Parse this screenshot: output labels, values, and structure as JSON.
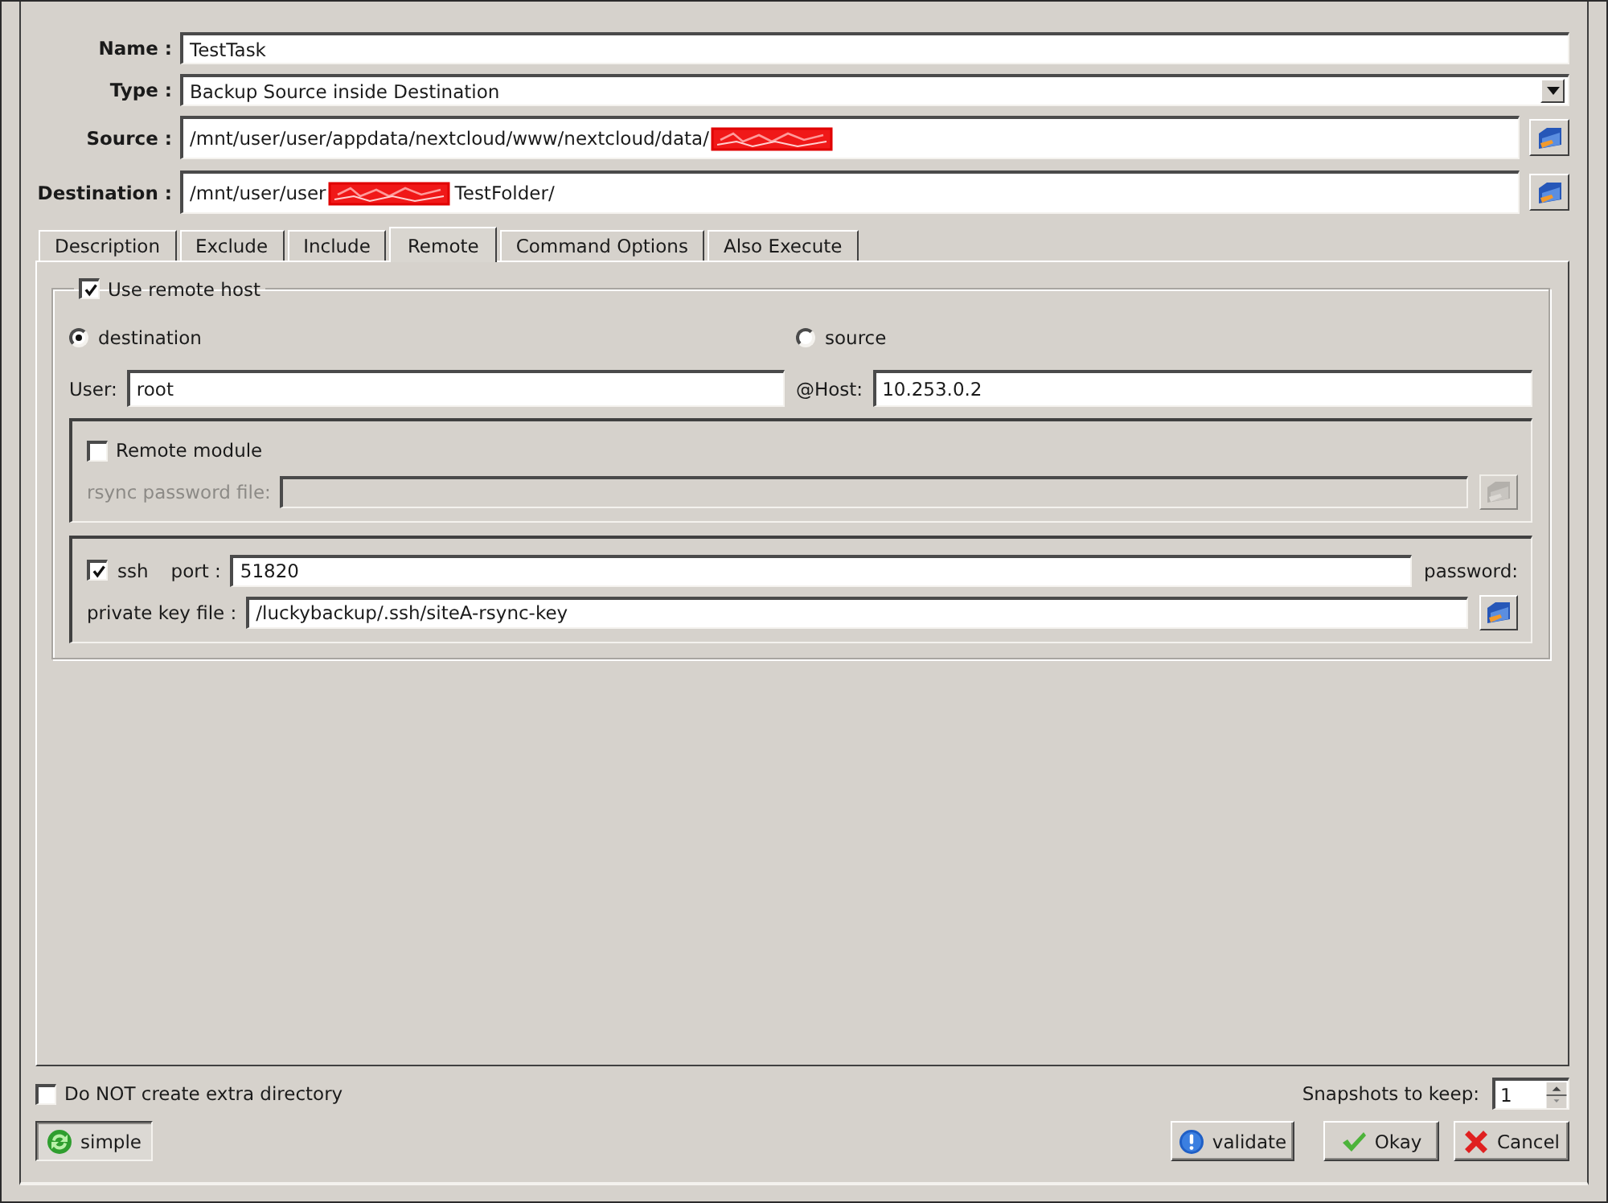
{
  "form": {
    "fields": [
      {
        "kind": "text",
        "label": "Name :",
        "value": "TestTask"
      },
      {
        "kind": "dropdown",
        "label": "Type :",
        "value": "Backup Source inside Destination"
      },
      {
        "kind": "path",
        "label": "Source :",
        "parts": [
          {
            "kind": "text",
            "text": "/mnt/user/user/appdata/nextcloud/www/nextcloud/data/"
          },
          {
            "kind": "redacted"
          }
        ]
      },
      {
        "kind": "path",
        "label": "Destination :",
        "parts": [
          {
            "kind": "text",
            "text": "/mnt/user/user"
          },
          {
            "kind": "redacted"
          },
          {
            "kind": "text",
            "text": "TestFolder/"
          }
        ]
      }
    ]
  },
  "tabs": [
    {
      "label": "Description",
      "selected": false
    },
    {
      "label": "Exclude",
      "selected": false
    },
    {
      "label": "Include",
      "selected": false
    },
    {
      "label": "Remote",
      "selected": true
    },
    {
      "label": "Command Options",
      "selected": false
    },
    {
      "label": "Also Execute",
      "selected": false
    }
  ],
  "remote": {
    "use_remote_host": {
      "label": "Use remote host",
      "checked": true
    },
    "direction": [
      {
        "label": "destination",
        "selected": true
      },
      {
        "label": "source",
        "selected": false
      }
    ],
    "user": {
      "label": "User:",
      "value": "root"
    },
    "host": {
      "label": "@Host:",
      "value": "10.253.0.2"
    },
    "remote_module": {
      "label": "Remote module",
      "checked": false
    },
    "rsync_password_file": {
      "label": "rsync password file:",
      "disabled": true
    },
    "ssh": {
      "label": "ssh",
      "checked": true
    },
    "port": {
      "label": "port :",
      "value": "51820"
    },
    "password": {
      "label": "password:"
    },
    "private_key_file": {
      "label": "private key file :",
      "value": "/luckybackup/.ssh/siteA-rsync-key"
    }
  },
  "footer": {
    "no_extra_directory": {
      "label": "Do NOT create extra directory",
      "checked": false
    },
    "mode": {
      "label": "simple",
      "pressed": true
    },
    "snapshots": {
      "label": "Snapshots to keep:",
      "value": "1"
    },
    "buttons": [
      {
        "kind": "validate",
        "label": "validate"
      },
      {
        "kind": "okay",
        "label": "Okay"
      },
      {
        "kind": "cancel",
        "label": "Cancel"
      }
    ]
  }
}
